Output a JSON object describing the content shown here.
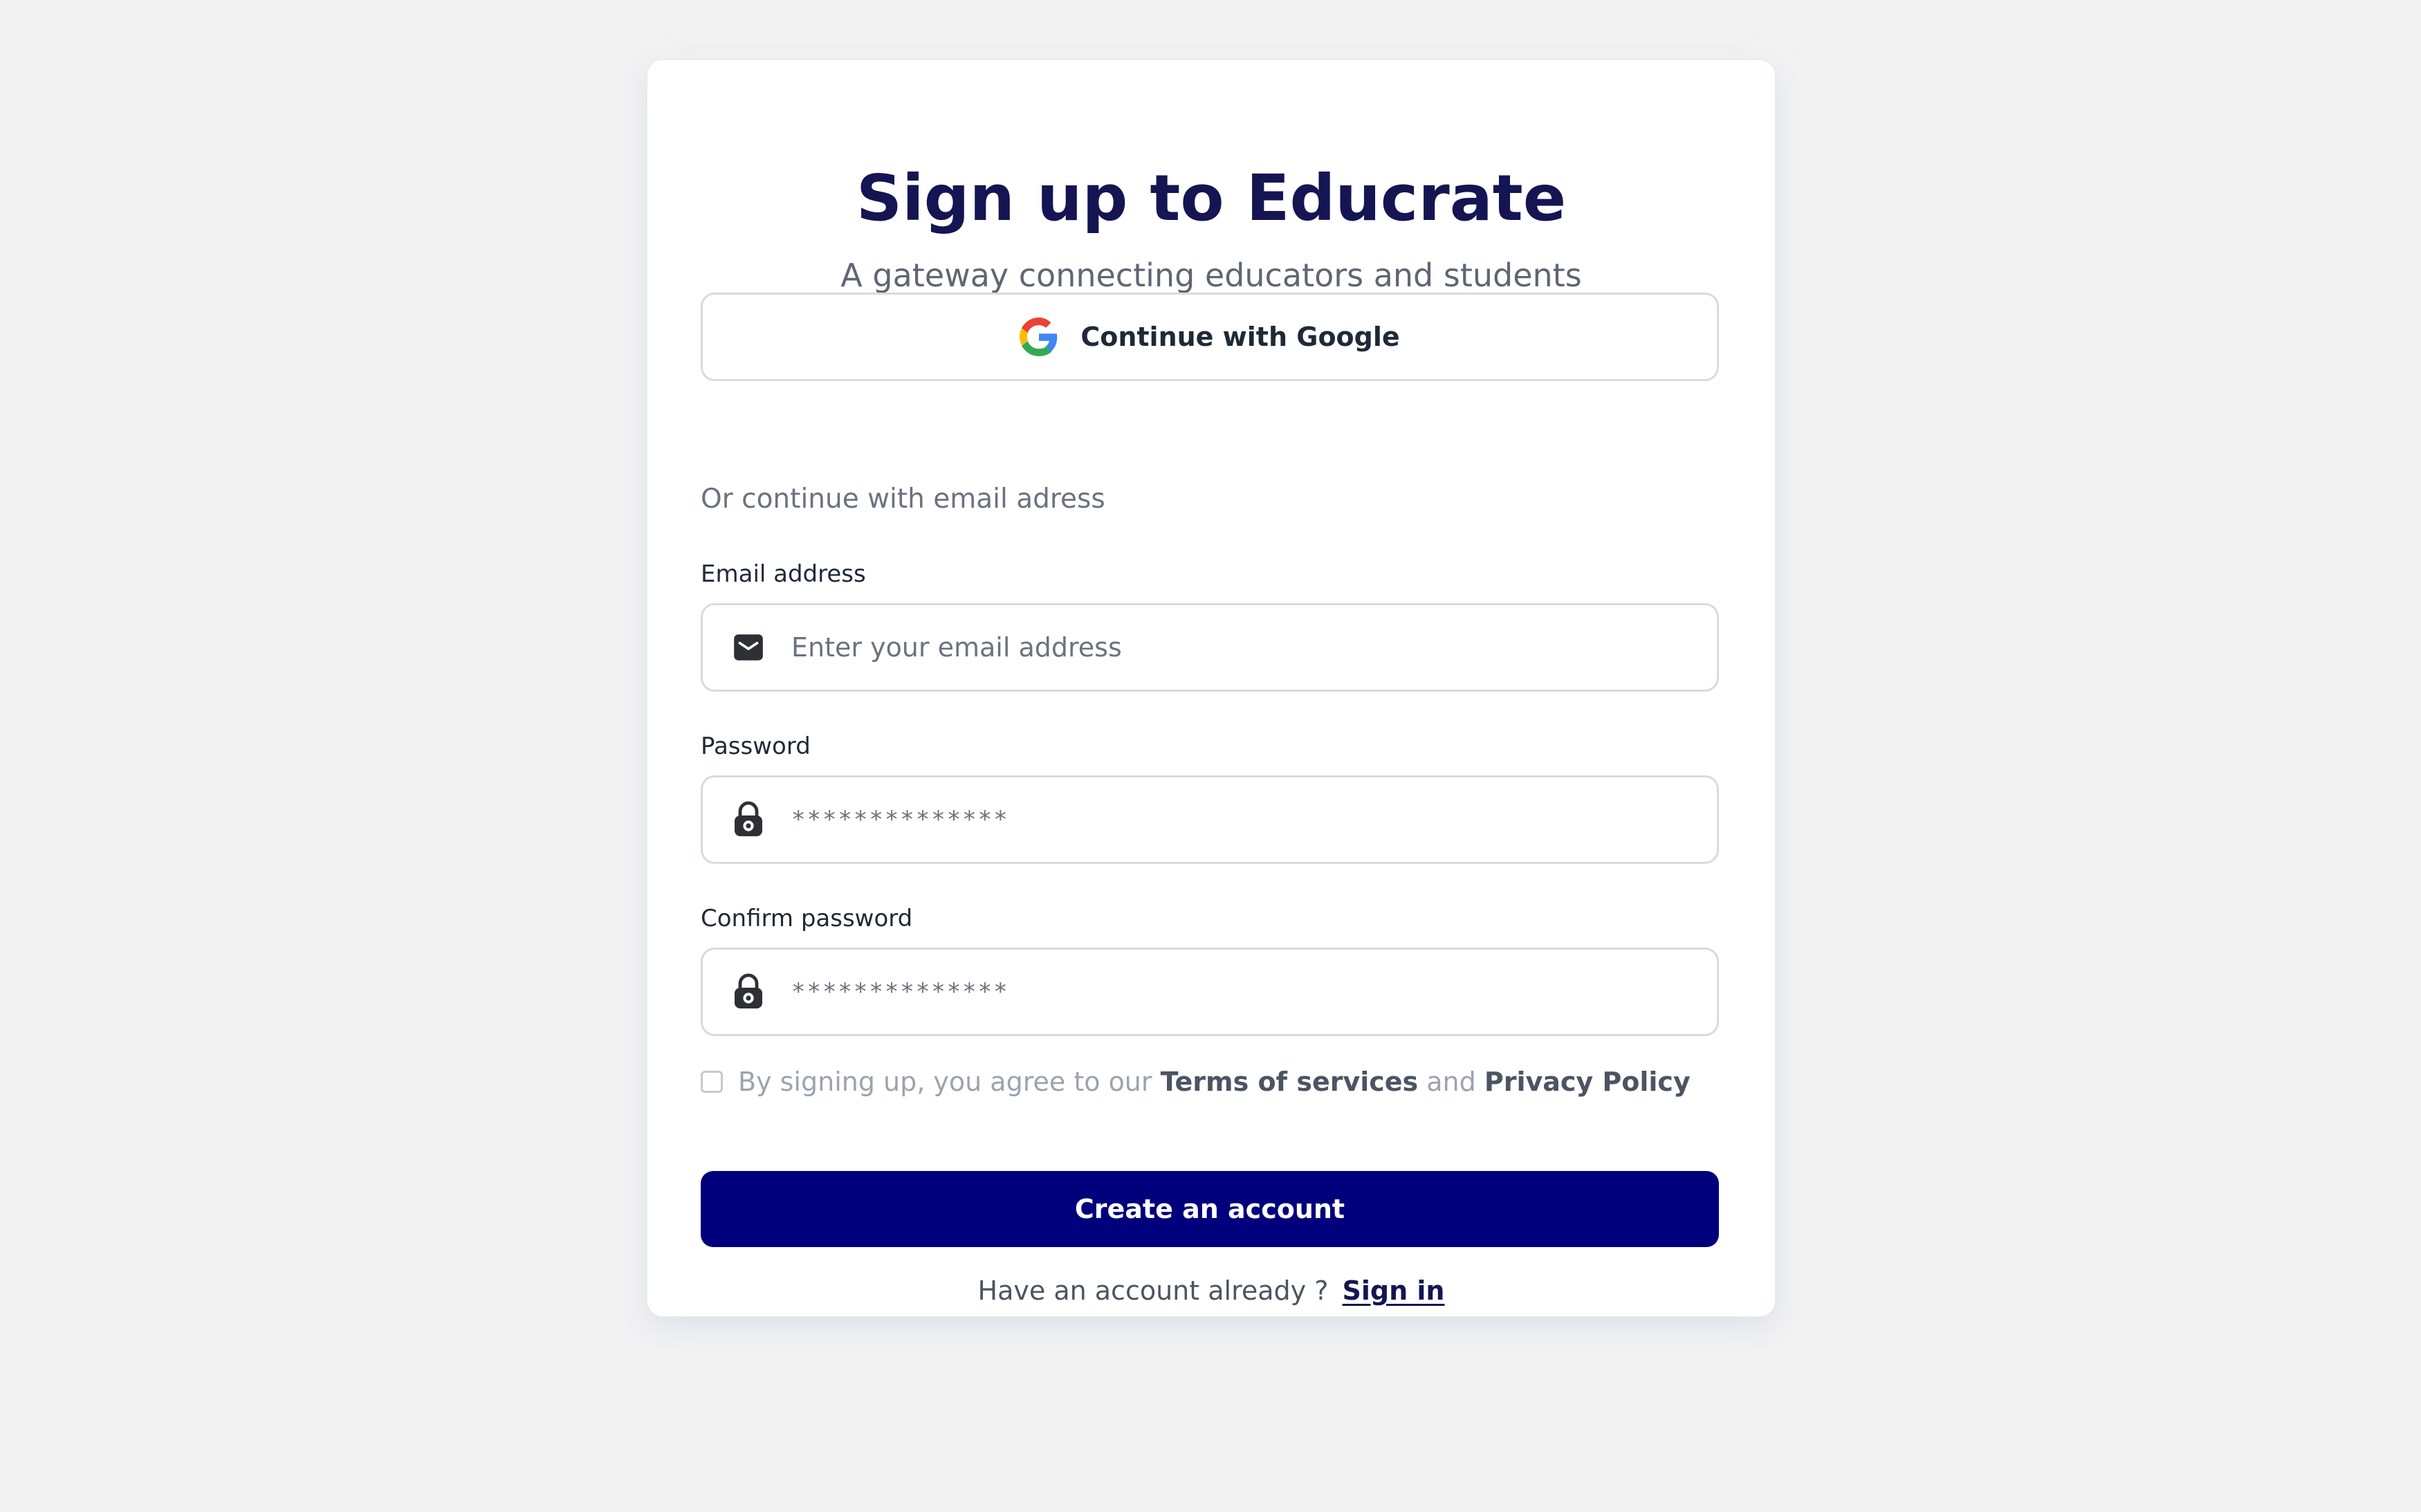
{
  "header": {
    "title": "Sign up to Educrate",
    "subtitle": "A gateway connecting educators and students"
  },
  "oauth": {
    "google_label": "Continue with Google",
    "google_icon": "google-icon"
  },
  "divider": {
    "text": "Or continue with email adress"
  },
  "form": {
    "email": {
      "label": "Email address",
      "placeholder": "Enter your email address",
      "icon": "mail-icon"
    },
    "password": {
      "label": "Password",
      "value": "**************",
      "icon": "lock-icon"
    },
    "confirm_password": {
      "label": "Confirm password",
      "value": "**************",
      "icon": "lock-icon"
    }
  },
  "terms": {
    "prefix": "By signing up, you agree to our",
    "terms_link": "Terms of services",
    "middle": "and",
    "privacy_link": "Privacy Policy"
  },
  "actions": {
    "create_label": "Create an account"
  },
  "footer": {
    "prompt": "Have an account already ?",
    "signin_label": "Sign in"
  },
  "colors": {
    "background": "#f2f2f3",
    "card": "#ffffff",
    "primary": "#00007d",
    "title": "#141552"
  }
}
